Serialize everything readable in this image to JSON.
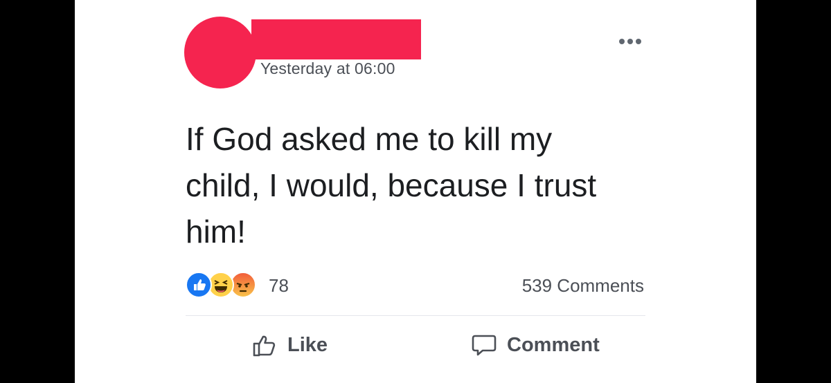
{
  "post": {
    "timestamp": "Yesterday at 06:00",
    "text": "If God asked me to kill my\nchild, I would, because  I trust\nhim!",
    "reaction_count": "78",
    "comment_count": "539 Comments",
    "reactions": [
      "like-icon",
      "haha-icon",
      "angry-icon"
    ]
  },
  "actions": {
    "like_label": "Like",
    "comment_label": "Comment"
  },
  "colors": {
    "redaction": "#f5244f",
    "like_blue": "#1877f2",
    "text": "#1c1e21",
    "secondary_text": "#4b4f56",
    "background": "#ffffff"
  }
}
